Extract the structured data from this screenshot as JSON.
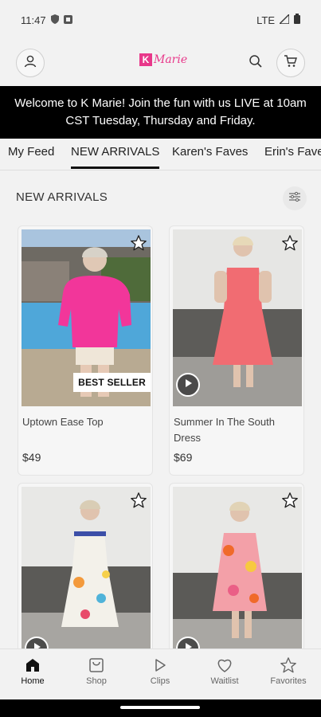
{
  "status": {
    "time": "11:47",
    "network": "LTE"
  },
  "header": {
    "logo_letter": "K",
    "logo_text": "Marie"
  },
  "banner": {
    "line1": "Welcome to K Marie! Join the fun with us LIVE at 10am",
    "line2": "CST Tuesday, Thursday and Friday."
  },
  "tabs": [
    {
      "label": "My Feed"
    },
    {
      "label": "NEW ARRIVALS"
    },
    {
      "label": "Karen's Faves"
    },
    {
      "label": "Erin's Faves"
    }
  ],
  "section": {
    "title": "NEW ARRIVALS"
  },
  "products": [
    {
      "name": "Uptown Ease Top",
      "price": "$49",
      "badge": "BEST SELLER"
    },
    {
      "name": "Summer In The South Dress",
      "price": "$69"
    },
    {
      "name": "",
      "price": ""
    },
    {
      "name": "",
      "price": ""
    }
  ],
  "nav": [
    {
      "label": "Home",
      "icon": "home-icon"
    },
    {
      "label": "Shop",
      "icon": "shop-icon"
    },
    {
      "label": "Clips",
      "icon": "play-icon"
    },
    {
      "label": "Waitlist",
      "icon": "heart-icon"
    },
    {
      "label": "Favorites",
      "icon": "star-icon"
    }
  ],
  "colors": {
    "brand": "#e8388a",
    "banner_bg": "#000000",
    "background": "#f2f2f2"
  }
}
